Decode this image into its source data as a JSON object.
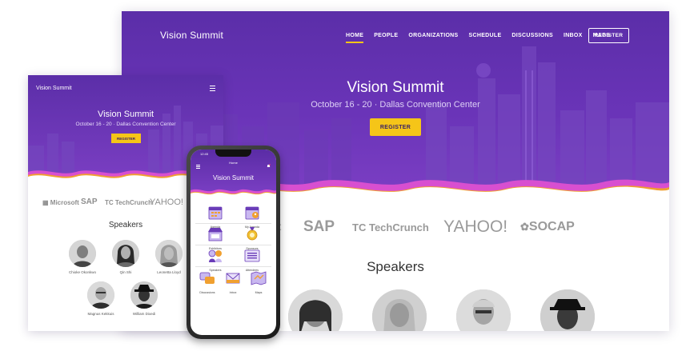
{
  "desktop": {
    "brand": "Vision Summit",
    "nav": [
      "HOME",
      "PEOPLE",
      "ORGANIZATIONS",
      "SCHEDULE",
      "DISCUSSIONS",
      "INBOX",
      "MAPS"
    ],
    "register_outline": "REGISTER",
    "title": "Vision Summit",
    "subtitle": "October 16 - 20 · Dallas Convention Center",
    "register": "REGISTER",
    "logos": [
      "ft",
      "SAP",
      "TechCrunch",
      "YAHOO!",
      "SOCAP"
    ],
    "speakers_title": "Speakers"
  },
  "tablet": {
    "brand": "Vision Summit",
    "title": "Vision Summit",
    "subtitle": "October 16 - 20 · Dallas Convention Center",
    "register": "REGISTER",
    "logos": [
      "Microsoft",
      "SAP",
      "TechCrunch",
      "YAHOO!"
    ],
    "speakers_title": "Speakers",
    "speakers": [
      "Chioke Okonkwo",
      "Qin Shi",
      "Leonetta Lloyd",
      "Magnus Kekkuis",
      "William Dixedi"
    ]
  },
  "phone": {
    "time": "12:45",
    "screen_title": "Home",
    "title": "Vision Summit",
    "tiles": [
      "Agenda",
      "My Agenda",
      "Exhibitors",
      "Sponsors",
      "Speakers",
      "Attendees",
      "Discussions",
      "Inbox",
      "Maps"
    ]
  },
  "colors": {
    "purple_dark": "#5b2ea8",
    "purple_light": "#7c3fc4",
    "accent_yellow": "#f5c518",
    "wave_orange": "#f0a030",
    "wave_pink": "#d84fd0"
  }
}
